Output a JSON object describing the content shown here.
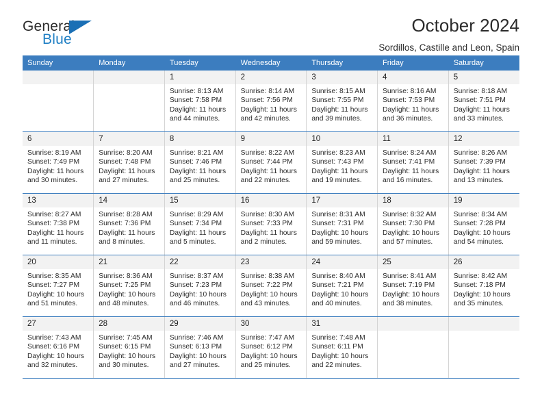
{
  "brand": {
    "word_one": "General",
    "word_two": "Blue",
    "triangle_icon": "blue-triangle-icon",
    "accent_color": "#1f7fc4"
  },
  "header": {
    "title": "October 2024",
    "subtitle": "Sordillos, Castille and Leon, Spain"
  },
  "theme": {
    "header_blue": "#3c7dbf",
    "daynum_gray": "#f2f2f2",
    "text": "#2b2b2b"
  },
  "weekdays": [
    "Sunday",
    "Monday",
    "Tuesday",
    "Wednesday",
    "Thursday",
    "Friday",
    "Saturday"
  ],
  "labels": {
    "sunrise_prefix": "Sunrise:",
    "sunset_prefix": "Sunset:",
    "daylight_prefix": "Daylight:"
  },
  "weeks": [
    [
      {
        "day": "",
        "sunrise": "",
        "sunset": "",
        "daylight_line1": "",
        "daylight_line2": ""
      },
      {
        "day": "",
        "sunrise": "",
        "sunset": "",
        "daylight_line1": "",
        "daylight_line2": ""
      },
      {
        "day": "1",
        "sunrise": "Sunrise: 8:13 AM",
        "sunset": "Sunset: 7:58 PM",
        "daylight_line1": "Daylight: 11 hours",
        "daylight_line2": "and 44 minutes."
      },
      {
        "day": "2",
        "sunrise": "Sunrise: 8:14 AM",
        "sunset": "Sunset: 7:56 PM",
        "daylight_line1": "Daylight: 11 hours",
        "daylight_line2": "and 42 minutes."
      },
      {
        "day": "3",
        "sunrise": "Sunrise: 8:15 AM",
        "sunset": "Sunset: 7:55 PM",
        "daylight_line1": "Daylight: 11 hours",
        "daylight_line2": "and 39 minutes."
      },
      {
        "day": "4",
        "sunrise": "Sunrise: 8:16 AM",
        "sunset": "Sunset: 7:53 PM",
        "daylight_line1": "Daylight: 11 hours",
        "daylight_line2": "and 36 minutes."
      },
      {
        "day": "5",
        "sunrise": "Sunrise: 8:18 AM",
        "sunset": "Sunset: 7:51 PM",
        "daylight_line1": "Daylight: 11 hours",
        "daylight_line2": "and 33 minutes."
      }
    ],
    [
      {
        "day": "6",
        "sunrise": "Sunrise: 8:19 AM",
        "sunset": "Sunset: 7:49 PM",
        "daylight_line1": "Daylight: 11 hours",
        "daylight_line2": "and 30 minutes."
      },
      {
        "day": "7",
        "sunrise": "Sunrise: 8:20 AM",
        "sunset": "Sunset: 7:48 PM",
        "daylight_line1": "Daylight: 11 hours",
        "daylight_line2": "and 27 minutes."
      },
      {
        "day": "8",
        "sunrise": "Sunrise: 8:21 AM",
        "sunset": "Sunset: 7:46 PM",
        "daylight_line1": "Daylight: 11 hours",
        "daylight_line2": "and 25 minutes."
      },
      {
        "day": "9",
        "sunrise": "Sunrise: 8:22 AM",
        "sunset": "Sunset: 7:44 PM",
        "daylight_line1": "Daylight: 11 hours",
        "daylight_line2": "and 22 minutes."
      },
      {
        "day": "10",
        "sunrise": "Sunrise: 8:23 AM",
        "sunset": "Sunset: 7:43 PM",
        "daylight_line1": "Daylight: 11 hours",
        "daylight_line2": "and 19 minutes."
      },
      {
        "day": "11",
        "sunrise": "Sunrise: 8:24 AM",
        "sunset": "Sunset: 7:41 PM",
        "daylight_line1": "Daylight: 11 hours",
        "daylight_line2": "and 16 minutes."
      },
      {
        "day": "12",
        "sunrise": "Sunrise: 8:26 AM",
        "sunset": "Sunset: 7:39 PM",
        "daylight_line1": "Daylight: 11 hours",
        "daylight_line2": "and 13 minutes."
      }
    ],
    [
      {
        "day": "13",
        "sunrise": "Sunrise: 8:27 AM",
        "sunset": "Sunset: 7:38 PM",
        "daylight_line1": "Daylight: 11 hours",
        "daylight_line2": "and 11 minutes."
      },
      {
        "day": "14",
        "sunrise": "Sunrise: 8:28 AM",
        "sunset": "Sunset: 7:36 PM",
        "daylight_line1": "Daylight: 11 hours",
        "daylight_line2": "and 8 minutes."
      },
      {
        "day": "15",
        "sunrise": "Sunrise: 8:29 AM",
        "sunset": "Sunset: 7:34 PM",
        "daylight_line1": "Daylight: 11 hours",
        "daylight_line2": "and 5 minutes."
      },
      {
        "day": "16",
        "sunrise": "Sunrise: 8:30 AM",
        "sunset": "Sunset: 7:33 PM",
        "daylight_line1": "Daylight: 11 hours",
        "daylight_line2": "and 2 minutes."
      },
      {
        "day": "17",
        "sunrise": "Sunrise: 8:31 AM",
        "sunset": "Sunset: 7:31 PM",
        "daylight_line1": "Daylight: 10 hours",
        "daylight_line2": "and 59 minutes."
      },
      {
        "day": "18",
        "sunrise": "Sunrise: 8:32 AM",
        "sunset": "Sunset: 7:30 PM",
        "daylight_line1": "Daylight: 10 hours",
        "daylight_line2": "and 57 minutes."
      },
      {
        "day": "19",
        "sunrise": "Sunrise: 8:34 AM",
        "sunset": "Sunset: 7:28 PM",
        "daylight_line1": "Daylight: 10 hours",
        "daylight_line2": "and 54 minutes."
      }
    ],
    [
      {
        "day": "20",
        "sunrise": "Sunrise: 8:35 AM",
        "sunset": "Sunset: 7:27 PM",
        "daylight_line1": "Daylight: 10 hours",
        "daylight_line2": "and 51 minutes."
      },
      {
        "day": "21",
        "sunrise": "Sunrise: 8:36 AM",
        "sunset": "Sunset: 7:25 PM",
        "daylight_line1": "Daylight: 10 hours",
        "daylight_line2": "and 48 minutes."
      },
      {
        "day": "22",
        "sunrise": "Sunrise: 8:37 AM",
        "sunset": "Sunset: 7:23 PM",
        "daylight_line1": "Daylight: 10 hours",
        "daylight_line2": "and 46 minutes."
      },
      {
        "day": "23",
        "sunrise": "Sunrise: 8:38 AM",
        "sunset": "Sunset: 7:22 PM",
        "daylight_line1": "Daylight: 10 hours",
        "daylight_line2": "and 43 minutes."
      },
      {
        "day": "24",
        "sunrise": "Sunrise: 8:40 AM",
        "sunset": "Sunset: 7:21 PM",
        "daylight_line1": "Daylight: 10 hours",
        "daylight_line2": "and 40 minutes."
      },
      {
        "day": "25",
        "sunrise": "Sunrise: 8:41 AM",
        "sunset": "Sunset: 7:19 PM",
        "daylight_line1": "Daylight: 10 hours",
        "daylight_line2": "and 38 minutes."
      },
      {
        "day": "26",
        "sunrise": "Sunrise: 8:42 AM",
        "sunset": "Sunset: 7:18 PM",
        "daylight_line1": "Daylight: 10 hours",
        "daylight_line2": "and 35 minutes."
      }
    ],
    [
      {
        "day": "27",
        "sunrise": "Sunrise: 7:43 AM",
        "sunset": "Sunset: 6:16 PM",
        "daylight_line1": "Daylight: 10 hours",
        "daylight_line2": "and 32 minutes."
      },
      {
        "day": "28",
        "sunrise": "Sunrise: 7:45 AM",
        "sunset": "Sunset: 6:15 PM",
        "daylight_line1": "Daylight: 10 hours",
        "daylight_line2": "and 30 minutes."
      },
      {
        "day": "29",
        "sunrise": "Sunrise: 7:46 AM",
        "sunset": "Sunset: 6:13 PM",
        "daylight_line1": "Daylight: 10 hours",
        "daylight_line2": "and 27 minutes."
      },
      {
        "day": "30",
        "sunrise": "Sunrise: 7:47 AM",
        "sunset": "Sunset: 6:12 PM",
        "daylight_line1": "Daylight: 10 hours",
        "daylight_line2": "and 25 minutes."
      },
      {
        "day": "31",
        "sunrise": "Sunrise: 7:48 AM",
        "sunset": "Sunset: 6:11 PM",
        "daylight_line1": "Daylight: 10 hours",
        "daylight_line2": "and 22 minutes."
      },
      {
        "day": "",
        "sunrise": "",
        "sunset": "",
        "daylight_line1": "",
        "daylight_line2": ""
      },
      {
        "day": "",
        "sunrise": "",
        "sunset": "",
        "daylight_line1": "",
        "daylight_line2": ""
      }
    ]
  ]
}
